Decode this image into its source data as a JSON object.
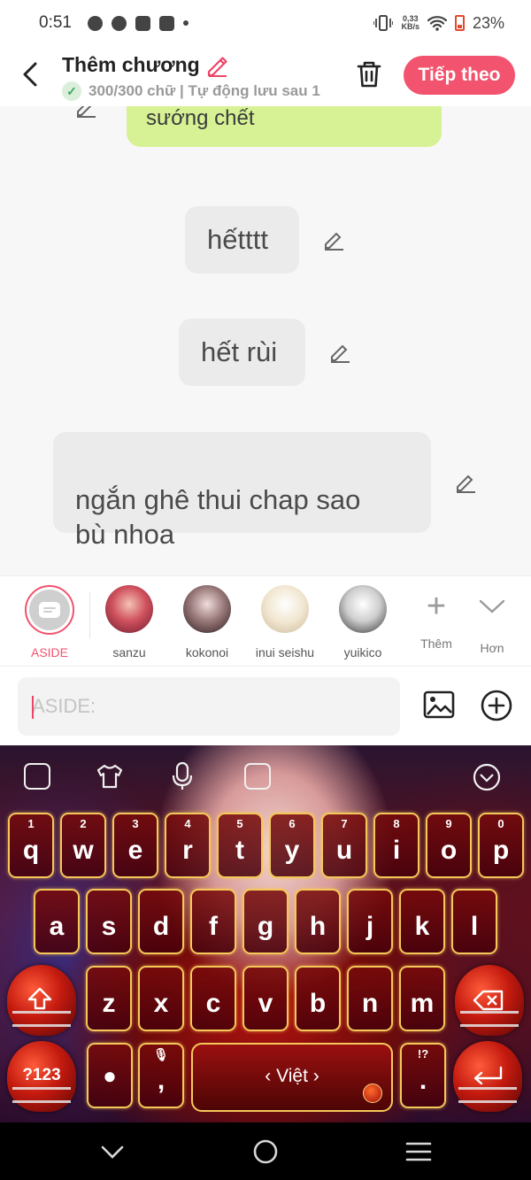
{
  "status_bar": {
    "time": "0:51",
    "net_speed_value": "0,33",
    "net_speed_unit": "KB/s",
    "battery": "23%"
  },
  "header": {
    "title": "Thêm chương",
    "subtitle": "300/300 chữ | Tự động lưu sau 1",
    "next_label": "Tiếp theo"
  },
  "chat": {
    "messages": [
      {
        "text": "sướng chết",
        "style": "green"
      },
      {
        "text": "hếtttt",
        "style": "gray"
      },
      {
        "text": "hết rùi",
        "style": "gray"
      },
      {
        "text": "ngắn ghê thui chap sao\nbù nhoa",
        "style": "gray"
      }
    ]
  },
  "characters": {
    "items": [
      {
        "name": "ASIDE",
        "selected": true
      },
      {
        "name": "sanzu"
      },
      {
        "name": "kokonoi"
      },
      {
        "name": "inui seishu"
      },
      {
        "name": "yuikico"
      }
    ],
    "add_label": "Thêm",
    "more_label": "Hơn"
  },
  "composer": {
    "placeholder": "ASIDE:"
  },
  "keyboard": {
    "row1": [
      {
        "hint": "1",
        "key": "q"
      },
      {
        "hint": "2",
        "key": "w"
      },
      {
        "hint": "3",
        "key": "e"
      },
      {
        "hint": "4",
        "key": "r"
      },
      {
        "hint": "5",
        "key": "t"
      },
      {
        "hint": "6",
        "key": "y"
      },
      {
        "hint": "7",
        "key": "u"
      },
      {
        "hint": "8",
        "key": "i"
      },
      {
        "hint": "9",
        "key": "o"
      },
      {
        "hint": "0",
        "key": "p"
      }
    ],
    "row2": [
      "a",
      "s",
      "d",
      "f",
      "g",
      "h",
      "j",
      "k",
      "l"
    ],
    "row3": [
      "z",
      "x",
      "c",
      "v",
      "b",
      "n",
      "m"
    ],
    "symbols_label": "?123",
    "comma": ",",
    "period": ".",
    "period_hint": "!?",
    "space_label": "‹  Việt  ›"
  },
  "colors": {
    "accent": "#f2536e",
    "green_bubble": "#d6f294",
    "gray_bubble": "#ebebeb"
  }
}
